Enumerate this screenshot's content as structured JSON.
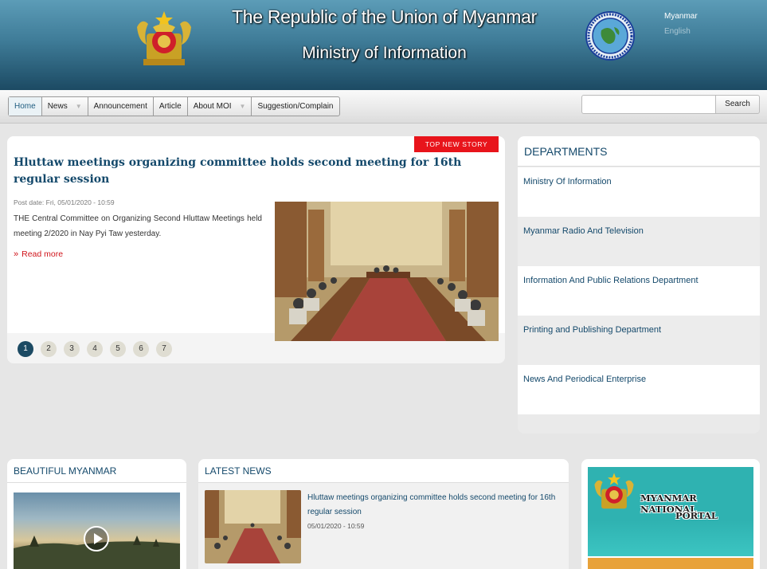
{
  "header": {
    "title": "The Republic of the Union of Myanmar",
    "subtitle": "Ministry of Information",
    "lang_primary": "Myanmar",
    "lang_secondary": "English"
  },
  "nav": {
    "items": [
      {
        "label": "Home"
      },
      {
        "label": "News"
      },
      {
        "label": "Announcement"
      },
      {
        "label": "Article"
      },
      {
        "label": "About MOI"
      },
      {
        "label": "Suggestion/Complain"
      }
    ],
    "search_placeholder": "",
    "search_button": "Search"
  },
  "top_story": {
    "badge": "TOP NEW STORY",
    "title": "Hluttaw meetings organizing committee holds second meeting for 16th regular session",
    "post_date": "Post date: Fri, 05/01/2020 - 10:59",
    "summary": "THE Central Committee on Organizing Second Hluttaw Meetings held meeting 2/2020 in Nay Pyi Taw yesterday.",
    "read_more": "Read more",
    "pages": [
      "1",
      "2",
      "3",
      "4",
      "5",
      "6",
      "7"
    ],
    "active_page": "1"
  },
  "departments": {
    "title": "DEPARTMENTS",
    "items": [
      {
        "label": "Ministry Of Information"
      },
      {
        "label": "Myanmar Radio And Television"
      },
      {
        "label": "Information And Public Relations Department"
      },
      {
        "label": "Printing and Publishing Department"
      },
      {
        "label": "News And Periodical Enterprise"
      }
    ]
  },
  "beautiful_myanmar": {
    "title": "BEAUTIFUL MYANMAR"
  },
  "latest_news": {
    "title": "LATEST NEWS",
    "item_title": "Hluttaw meetings organizing committee holds second meeting for 16th regular session",
    "item_date": "05/01/2020 - 10:59"
  },
  "portal": {
    "line1": "MYANMAR NATIONAL",
    "line2": "PORTAL"
  },
  "colors": {
    "header_dark": "#1c4a63",
    "header_light": "#5c9cb7",
    "accent_red": "#e8141b",
    "link_blue": "#14496b"
  },
  "icons": {
    "emblem": "state-emblem-icon",
    "seal": "moi-seal-icon",
    "play": "play-icon"
  }
}
